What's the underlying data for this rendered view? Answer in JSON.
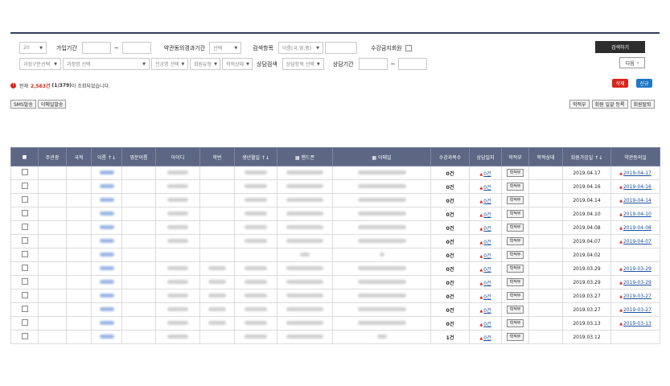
{
  "search": {
    "page_size": "20",
    "join_period_label": "가입기간",
    "tilde": "~",
    "terms_period_label": "약관동의경과기간",
    "terms_period_select": "선택",
    "search_item_label": "검색항목",
    "search_item_select": "이름(국,영,중)",
    "no_course_label": "수강금지회원",
    "search_button": "검색하기",
    "course_type_select": "과정구분선택",
    "course_select": "과정명 선택",
    "major_select": "전공명 선택",
    "member_type_select": "회원유형",
    "academic_select": "학적상태",
    "consult_search_label": "상담검색",
    "consult_item_select": "상담항목 선택",
    "consult_period_label": "상담기간",
    "next_button": "다음"
  },
  "summary": {
    "prefix": "현재",
    "count": "2,563건",
    "pages": "(1/379)",
    "suffix": "이 조회되었습니다."
  },
  "actions": {
    "delete": "삭제",
    "new": "신규",
    "sms": "SMS발송",
    "email": "이메일발송",
    "academic": "학적부",
    "bulk_register": "회원 일괄 등록",
    "withdraw": "회원탈퇴"
  },
  "columns": [
    "■",
    "주관광",
    "국적",
    "이름 ↑↓",
    "영문이름",
    "아이디",
    "학번",
    "생년월일 ↑↓",
    "▦ 핸드폰",
    "▦ 이메일",
    "수강과목수",
    "상담일지",
    "학적부",
    "학적상태",
    "회원가입일 ↑↓",
    "약관동의일"
  ],
  "rows": [
    {
      "count": "0건",
      "consult": "0건",
      "academic": "학적부",
      "join": "2019.04.17",
      "agree": "2019-04-17"
    },
    {
      "count": "0건",
      "consult": "0건",
      "academic": "학적부",
      "join": "2019.04.16",
      "agree": "2019-04-16"
    },
    {
      "count": "0건",
      "consult": "0건",
      "academic": "학적부",
      "join": "2019.04.14",
      "agree": "2019-04-14"
    },
    {
      "count": "0건",
      "consult": "0건",
      "academic": "학적부",
      "join": "2019.04.10",
      "agree": "2019-04-10"
    },
    {
      "count": "0건",
      "consult": "0건",
      "academic": "학적부",
      "join": "2019.04.08",
      "agree": "2019-04-08"
    },
    {
      "count": "0건",
      "consult": "0건",
      "academic": "학적부",
      "join": "2019.04.07",
      "agree": "2019-04-07"
    },
    {
      "count": "0건",
      "consult": "0건",
      "academic": "학적부",
      "join": "2019.04.02",
      "agree": ""
    },
    {
      "count": "0건",
      "consult": "0건",
      "academic": "학적부",
      "join": "2019.03.29",
      "agree": "2019-03-29"
    },
    {
      "count": "0건",
      "consult": "0건",
      "academic": "학적부",
      "join": "2019.03.29",
      "agree": "2019-03-29"
    },
    {
      "count": "0건",
      "consult": "0건",
      "academic": "학적부",
      "join": "2019.03.27",
      "agree": "2019-03-27"
    },
    {
      "count": "0건",
      "consult": "0건",
      "academic": "학적부",
      "join": "2019.03.27",
      "agree": "2019-03-27"
    },
    {
      "count": "0건",
      "consult": "0건",
      "academic": "학적부",
      "join": "2019.03.13",
      "agree": "2019-03-13"
    },
    {
      "count": "1건",
      "consult": "0건",
      "academic": "학적부",
      "join": "2019.03.12",
      "agree": ""
    }
  ],
  "colors": {
    "header_bg": "#5d6784",
    "delete": "#d9251d",
    "new": "#1f78c8",
    "search": "#2d2d2d"
  }
}
